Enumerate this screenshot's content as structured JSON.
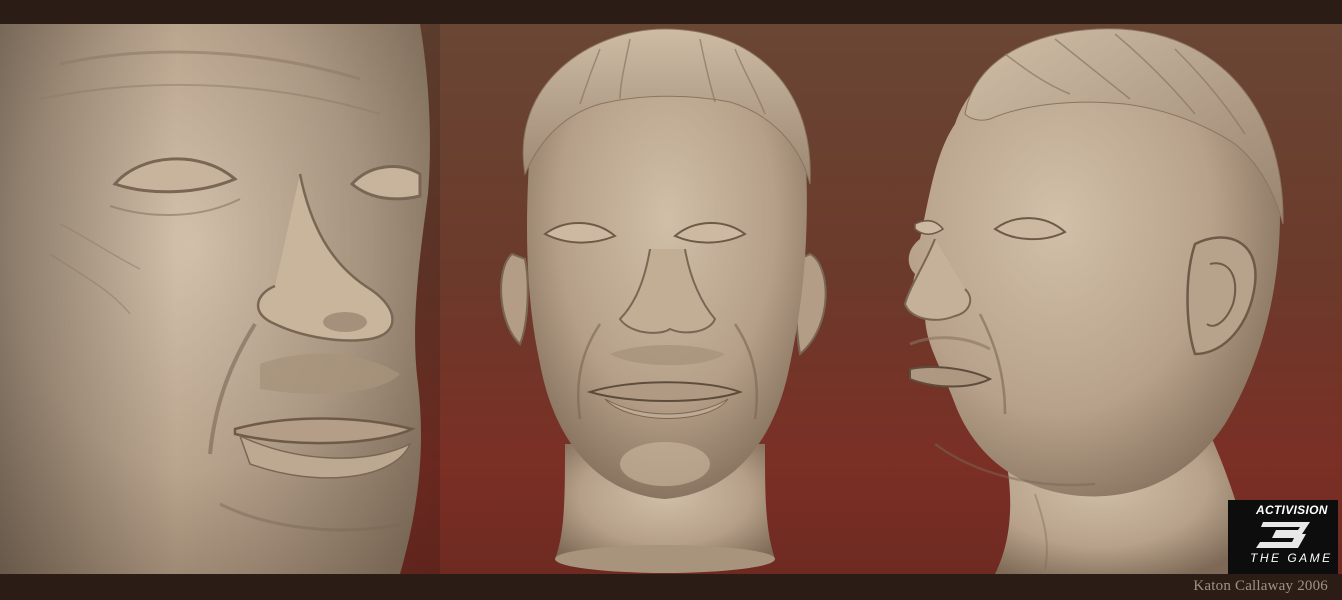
{
  "branding": {
    "publisher": "ACTIVISION",
    "game_number": "3",
    "game_subtitle": "THE GAME"
  },
  "credit": "Katon Callaway 2006",
  "colors": {
    "border": "#2b1d15",
    "backdrop_top": "#6a4634",
    "backdrop_bottom": "#7b2f25",
    "clay": "#c2ad96",
    "credit_text": "#a09282"
  }
}
